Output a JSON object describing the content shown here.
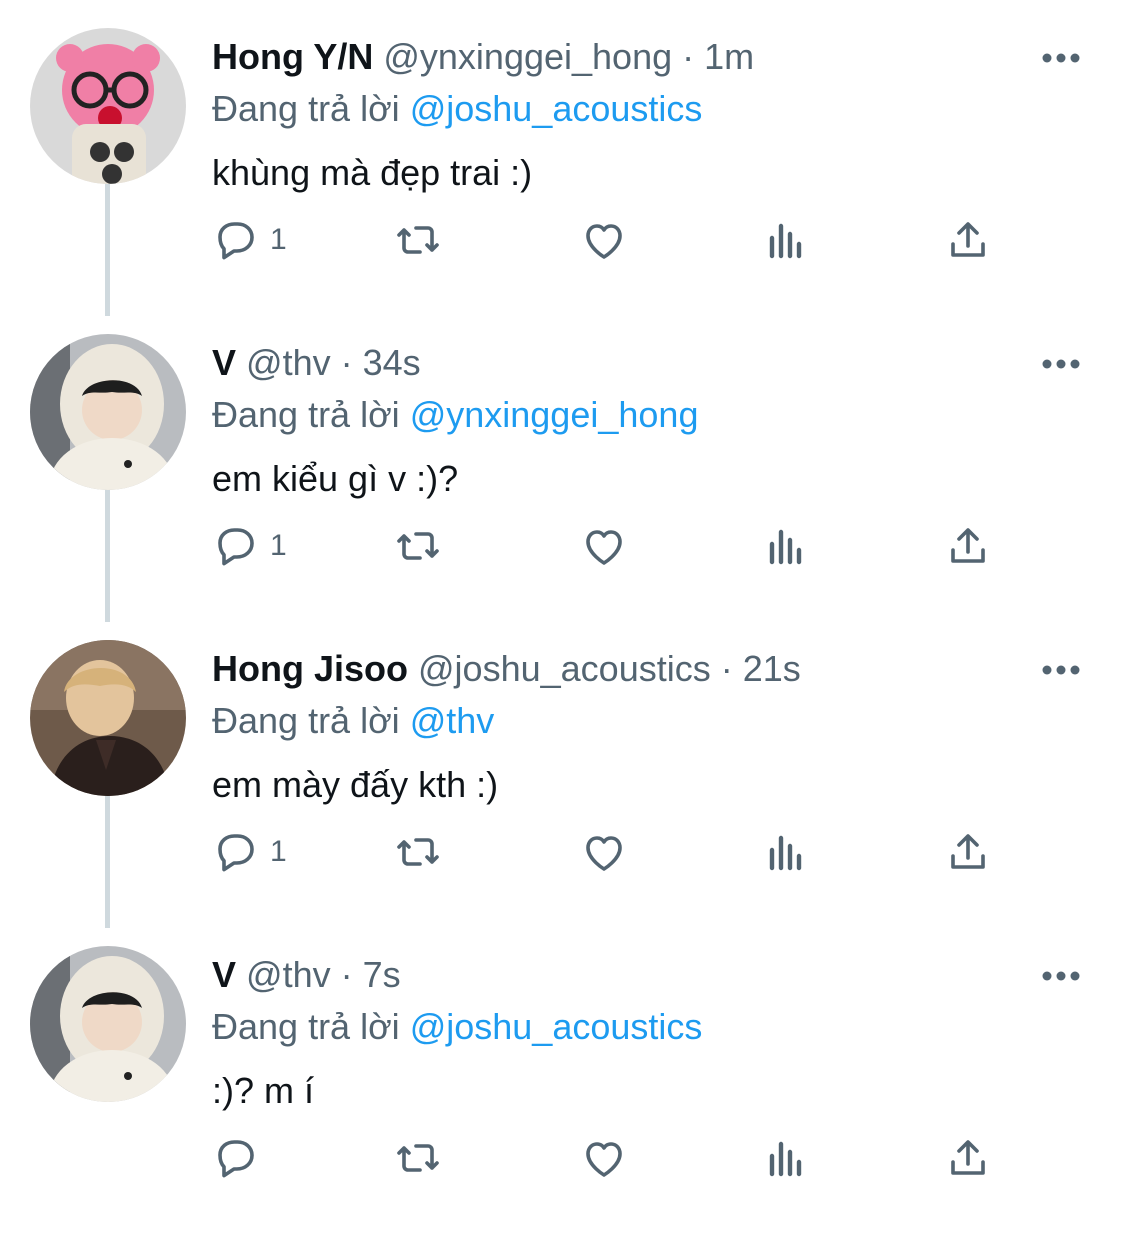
{
  "tweets": [
    {
      "name": "Hong Y/N",
      "handle": "@ynxinggei_hong",
      "separator": "·",
      "time": "1m",
      "replying_prefix": "Đang trả lời",
      "replying_to": "@joshu_acoustics",
      "text": "khùng mà đẹp trai :)",
      "reply_count": "1",
      "avatar": "pink-plush-avatar"
    },
    {
      "name": "V",
      "handle": "@thv",
      "separator": "·",
      "time": "34s",
      "replying_prefix": "Đang trả lời",
      "replying_to": "@ynxinggei_hong",
      "text": "em kiểu gì v :)?",
      "reply_count": "1",
      "avatar": "hooded-person-avatar"
    },
    {
      "name": "Hong Jisoo",
      "handle": "@joshu_acoustics",
      "separator": "·",
      "time": "21s",
      "replying_prefix": "Đang trả lời",
      "replying_to": "@thv",
      "text": "em mày đấy kth :)",
      "reply_count": "1",
      "avatar": "blond-person-avatar"
    },
    {
      "name": "V",
      "handle": "@thv",
      "separator": "·",
      "time": "7s",
      "replying_prefix": "Đang trả lời",
      "replying_to": "@joshu_acoustics",
      "text": ":)? m í",
      "reply_count": "",
      "avatar": "hooded-person-avatar"
    }
  ],
  "colors": {
    "text": "#0f1419",
    "secondary": "#536471",
    "accent": "#1d9bf0",
    "thread_line": "#cfd9de"
  },
  "icons": [
    "reply-icon",
    "retweet-icon",
    "like-icon",
    "views-icon",
    "share-icon",
    "more-icon"
  ]
}
